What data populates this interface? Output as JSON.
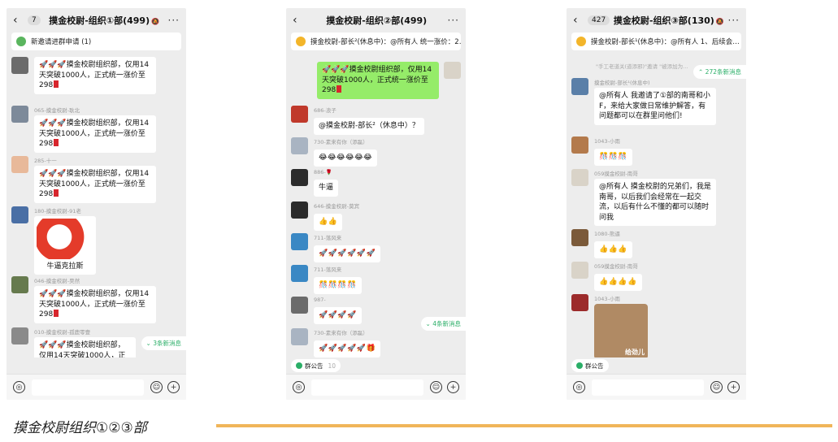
{
  "phone1": {
    "back_count": "7",
    "title": "摸金校尉-组织①部(499)",
    "mute": "🔕",
    "more": "···",
    "banner": "新邀请进群申请 (1)",
    "new_msgs": "⌄ 3条新消息",
    "messages": [
      {
        "nick": "",
        "text": "🚀🚀🚀摸金校尉组织部，仅用14天突破1000人，正式统一涨价至298"
      },
      {
        "nick": "065-摸金校尉-耿北",
        "text": "🚀🚀🚀摸金校尉组织部，仅用14天突破1000人，正式统一涨价至298"
      },
      {
        "nick": "285-十一",
        "text": "🚀🚀🚀摸金校尉组织部，仅用14天突破1000人，正式统一涨价至298"
      },
      {
        "nick": "180-摸金校尉-91老",
        "sticker_text": "牛逼克拉斯"
      },
      {
        "nick": "046-摸金校尉-昊然",
        "text": "🚀🚀🚀摸金校尉组织部，仅用14天突破1000人，正式统一涨价至298"
      },
      {
        "nick": "010-摸金校尉-孤鹿零壹",
        "text": "🚀🚀🚀摸金校尉组织部，仅用14天突破1000人，正式统一涨价至298"
      }
    ]
  },
  "phone2": {
    "title": "摸金校尉-组织②部(499)",
    "more": "···",
    "banner": "摸金校尉-部长²(休息中)：@所有人 统一涨价：2…",
    "new_msgs": "⌄ 4条新消息",
    "gonggao": "群公告",
    "gonggao_count": "10",
    "my_message": "🚀🚀🚀摸金校尉组织部，仅用14天突破1000人，正式统一涨价至298",
    "messages": [
      {
        "nick": "686-浪子",
        "text": "@摸金校尉-部长²（休息中）？"
      },
      {
        "nick": "730-素来有你（添磊）",
        "text": "😂😂😂😂😂😂"
      },
      {
        "nick": "886-🌹",
        "text": "牛逼"
      },
      {
        "nick": "646-摸金校尉-莫宾",
        "text": "👍👍"
      },
      {
        "nick": "711-落风来",
        "text": "🚀🚀🚀🚀🚀🚀"
      },
      {
        "nick": "711-落风来",
        "text": "🎊🎊🎊🎊"
      },
      {
        "nick": "987-",
        "text": "🚀🚀🚀🚀"
      },
      {
        "nick": "730-素来有你（添磊）",
        "text": "🚀🚀🚀🚀🚀🎁"
      }
    ]
  },
  "phone3": {
    "back_count": "427",
    "title": "摸金校尉-组织③部(130)",
    "mute": "🔕",
    "more": "···",
    "banner": "摸金校尉-部长¹(休息中)：@所有人 1、后续会…",
    "new_msgs": "⌃ 272条新消息",
    "system_notice": "\"手工老道关(道添邪)\"邀请 \"被添加为…",
    "gonggao": "群公告",
    "messages": [
      {
        "nick": "摸金校尉-部长¹(休息中)",
        "text": "@所有人  我邀请了①部的南哥和小F，来给大家做日常维护解答，有问题都可以在群里问他们!"
      },
      {
        "nick": "1043-小雨",
        "text": "🎊🎊🎊"
      },
      {
        "nick": "059摸金校尉-南哥",
        "text": "@所有人  摸金校尉的兄弟们，我是南哥，以后我们会经常在一起交流，以后有什么不懂的都可以随时问我"
      },
      {
        "nick": "1080-熊逼",
        "text": "👍👍👍"
      },
      {
        "nick": "059摸金校尉-南哥",
        "text": "👍👍👍👍"
      },
      {
        "nick": "1043-小雨",
        "sticker_text": "给劲儿"
      }
    ]
  },
  "caption": "摸金校尉组织①②③部",
  "colors": {
    "accent_green": "#2aae67",
    "bubble_green": "#95ec69",
    "rule": "#f0b55a"
  }
}
